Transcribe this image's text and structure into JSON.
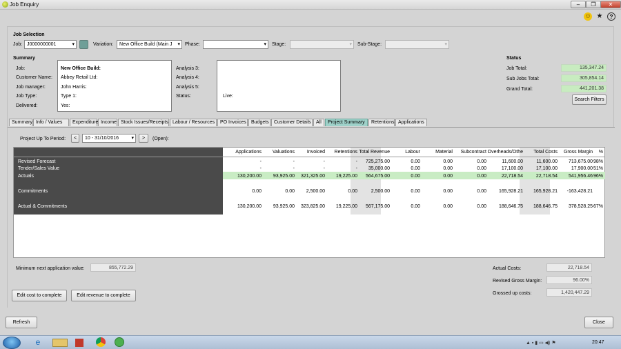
{
  "window": {
    "title": "Job Enquiry"
  },
  "job_selection": {
    "heading": "Job Selection",
    "job_label": "Job:",
    "job_value": "J0000000001",
    "variation_label": "Variation:",
    "variation_value": "New Office Build (Main J",
    "phase_label": "Phase:",
    "phase_value": "",
    "stage_label": "Stage:",
    "substage_label": "Sub-Stage:"
  },
  "summary": {
    "heading": "Summary",
    "job_label": "Job:",
    "job_value": "New Office Build:",
    "customer_label": "Customer Name:",
    "customer_value": "Abbey Retail Ltd:",
    "manager_label": "Job manager:",
    "manager_value": "John Harris:",
    "type_label": "Job Type:",
    "type_value": "Type 1:",
    "delivered_label": "Delivered:",
    "delivered_value": "Yes:",
    "analysis3": "Analysis 3:",
    "analysis4": "Analysis 4:",
    "analysis5": "Analysis 5:",
    "status_label": "Status:",
    "status_value": "Live:"
  },
  "status": {
    "heading": "Status",
    "job_total_label": "Job Total:",
    "job_total": "135,347.24",
    "sub_jobs_label": "Sub Jobs Total:",
    "sub_jobs": "305,854.14",
    "grand_label": "Grand Total:",
    "grand": "441,201.38",
    "search_filters": "Search Filters"
  },
  "tabs": [
    "Summary",
    "Info / Values",
    "Expenditure",
    "Income",
    "Stock Issues/Receipts",
    "Labour / Resources",
    "PO Invoices",
    "Budgets",
    "Customer Details",
    "All",
    "Project Summary",
    "Retentions",
    "Applications"
  ],
  "period": {
    "label": "Project Up To Period:",
    "value": "10 - 31/10/2016",
    "prev": "<",
    "next": ">",
    "status": "(Open):"
  },
  "grid": {
    "columns": [
      "Applications",
      "Valuations",
      "Invoiced",
      "Retentions",
      "Total Revenue",
      "Labour",
      "Material",
      "Subcontract",
      "Overheads/Othe",
      "Total Costs",
      "Gross Margin",
      "%"
    ],
    "rows": [
      {
        "label": "Revised Forecast",
        "values": [
          "-",
          "-",
          "-",
          "-",
          "725,275.00",
          "0.00",
          "0.00",
          "0.00",
          "11,600.00",
          "11,600.00",
          "713,675.00",
          "98%"
        ]
      },
      {
        "label": "Tender/Sales Value",
        "values": [
          "-",
          "-",
          "-",
          "-",
          "35,000.00",
          "0.00",
          "0.00",
          "0.00",
          "17,100.00",
          "17,100.00",
          "17,900.00",
          "51%"
        ]
      },
      {
        "label": "Actuals",
        "values": [
          "130,200.00",
          "93,925.00",
          "321,325.00",
          "19,225.00",
          "564,675.00",
          "0.00",
          "0.00",
          "0.00",
          "22,718.54",
          "22,718.54",
          "541,956.46",
          "96%"
        ]
      },
      {
        "label": "Commitments",
        "values": [
          "0.00",
          "0.00",
          "2,500.00",
          "0.00",
          "2,500.00",
          "0.00",
          "0.00",
          "0.00",
          "165,928.21",
          "165,928.21",
          "-163,428.21",
          ""
        ]
      },
      {
        "label": "Actual & Commitments",
        "values": [
          "130,200.00",
          "93,925.00",
          "323,825.00",
          "19,225.00",
          "567,175.00",
          "0.00",
          "0.00",
          "0.00",
          "188,646.75",
          "188,646.75",
          "378,528.25",
          "67%"
        ]
      }
    ]
  },
  "footer": {
    "min_app_label": "Minimum next application value:",
    "min_app_value": "855,772.29",
    "edit_cost": "Edit cost to complete",
    "edit_revenue": "Edit revenue to complete",
    "actual_costs_label": "Actual Costs:",
    "actual_costs": "22,718.54",
    "revised_gm_label": "Revised Gross Margin:",
    "revised_gm": "96.00%",
    "grossed_label": "Grossed up costs:",
    "grossed": "1,420,447.29"
  },
  "buttons": {
    "refresh": "Refresh",
    "close": "Close"
  },
  "taskbar": {
    "clock": "20:47"
  },
  "colors": {
    "actuals_row": "#c9ecc4",
    "active_tab": "#9ed1c9",
    "row_header": "#4a4a4a"
  }
}
